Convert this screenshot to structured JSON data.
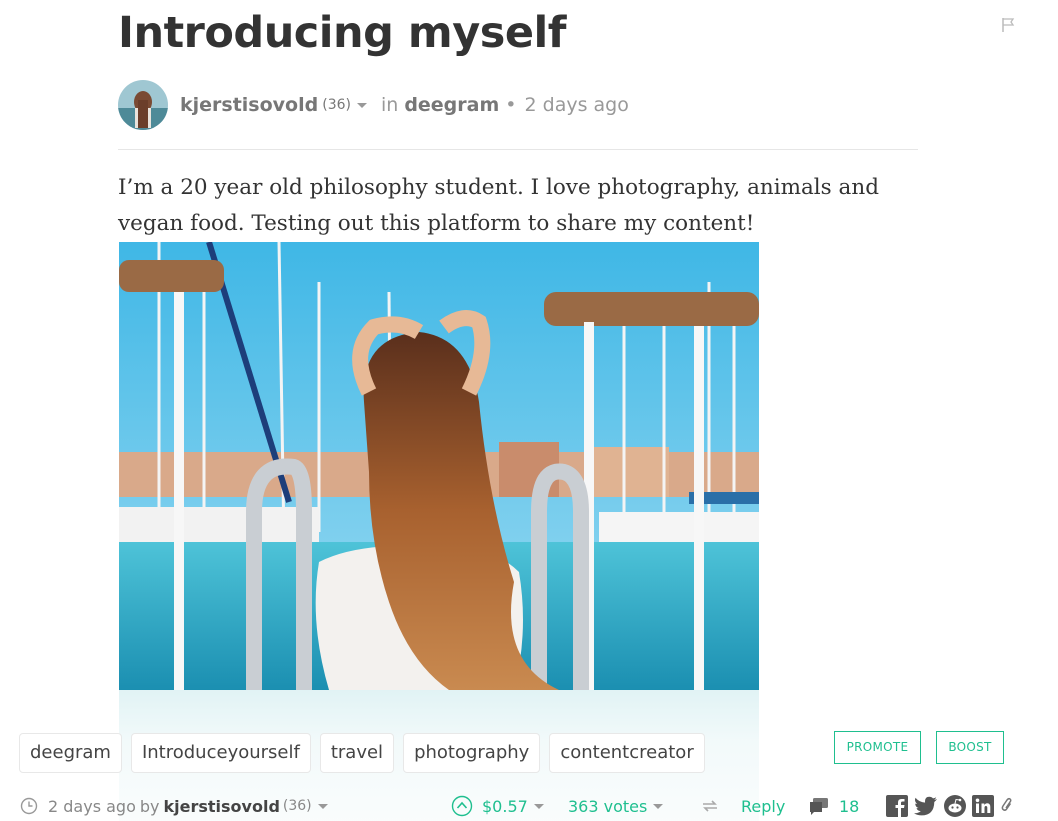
{
  "post": {
    "title": "Introducing myself",
    "author": "kjerstisovold",
    "reputation": "(36)",
    "in_label": "in",
    "community": "deegram",
    "time_ago": "2 days ago",
    "body": "I’m a 20 year old philosophy student. I love photography, animals and vegan food. Testing out this platform to share my content!"
  },
  "tags": [
    "deegram",
    "Introduceyourself",
    "travel",
    "photography",
    "contentcreator"
  ],
  "actions": {
    "promote_label": "PROMOTE",
    "boost_label": "BOOST"
  },
  "footer": {
    "time_ago": "2 days ago",
    "by_label": "by",
    "author": "kjerstisovold",
    "reputation": "(36)",
    "payout": "$0.57",
    "votes": "363 votes",
    "reply_label": "Reply",
    "comments": "18"
  },
  "icons": [
    "flag-icon",
    "clock-icon",
    "upvote-icon",
    "reblog-icon",
    "comment-icon",
    "facebook-icon",
    "twitter-icon",
    "reddit-icon",
    "linkedin-icon",
    "link-icon"
  ],
  "colors": {
    "accent": "#1fbf8f",
    "text": "#333333",
    "muted": "#888888"
  }
}
